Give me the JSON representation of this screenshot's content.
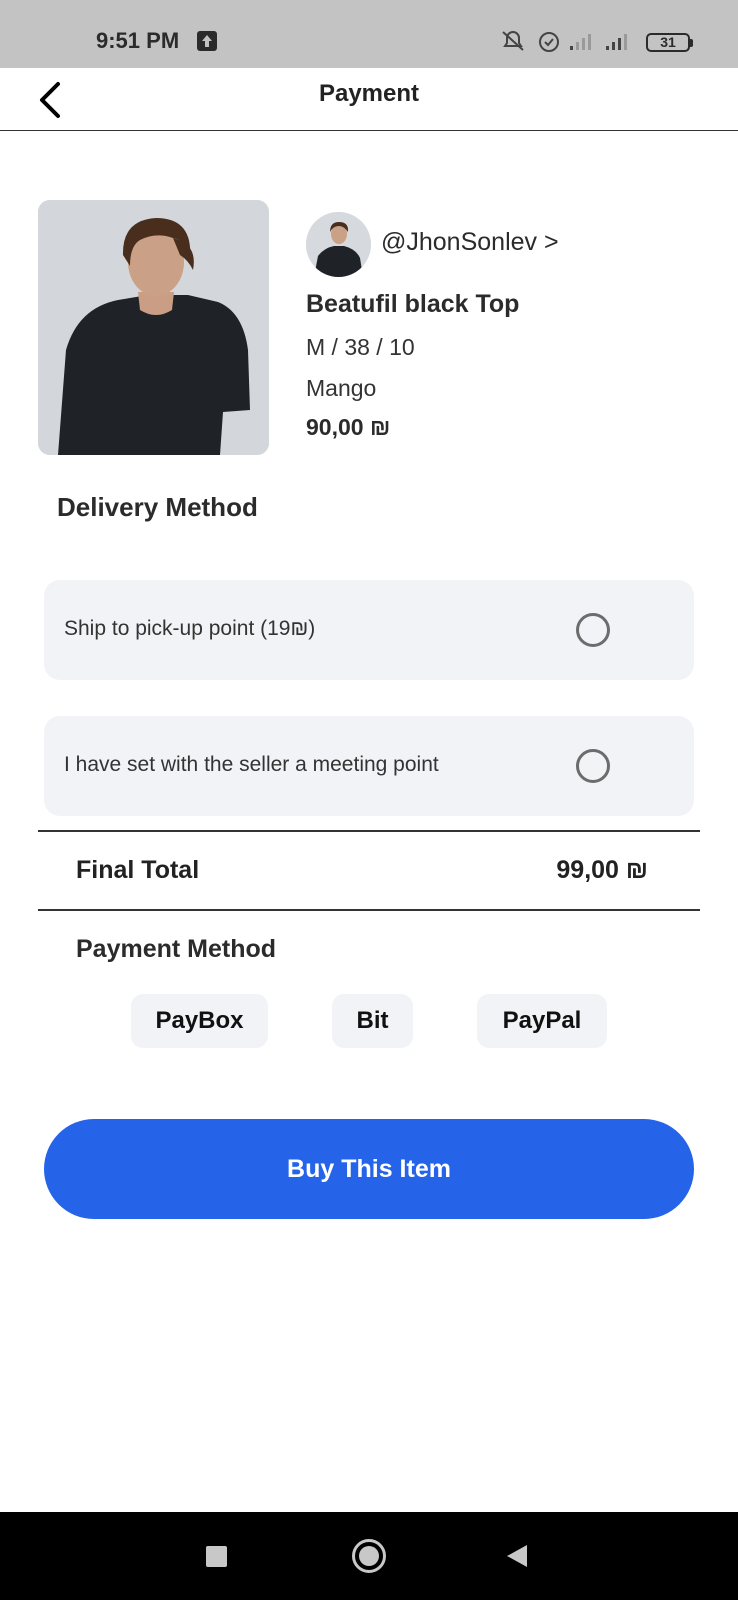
{
  "status_bar": {
    "time": "9:51 PM",
    "battery": "31",
    "icons": [
      "upload-icon",
      "mute-icon",
      "alarm-icon",
      "signal-icon",
      "signal-icon",
      "battery-icon"
    ]
  },
  "header": {
    "title": "Payment",
    "back_icon": "chevron-left-icon"
  },
  "product": {
    "seller": "@JhonSonlev >",
    "name": "Beatufil black Top",
    "size": "M / 38 / 10",
    "brand": "Mango",
    "price": "90,00 ₪"
  },
  "delivery": {
    "title": "Delivery Method",
    "options": [
      {
        "label": "Ship to pick-up point (19₪)",
        "selected": false
      },
      {
        "label": "I have set with the seller a meeting point",
        "selected": false
      }
    ]
  },
  "total": {
    "label": "Final Total",
    "value": "99,00 ₪"
  },
  "payment": {
    "title": "Payment Method",
    "methods": [
      "PayBox",
      "Bit",
      "PayPal"
    ]
  },
  "cta": {
    "label": "Buy This Item",
    "color": "#2563e8"
  },
  "nav_bar": {
    "icons": [
      "recents-icon",
      "home-icon",
      "back-icon"
    ]
  }
}
